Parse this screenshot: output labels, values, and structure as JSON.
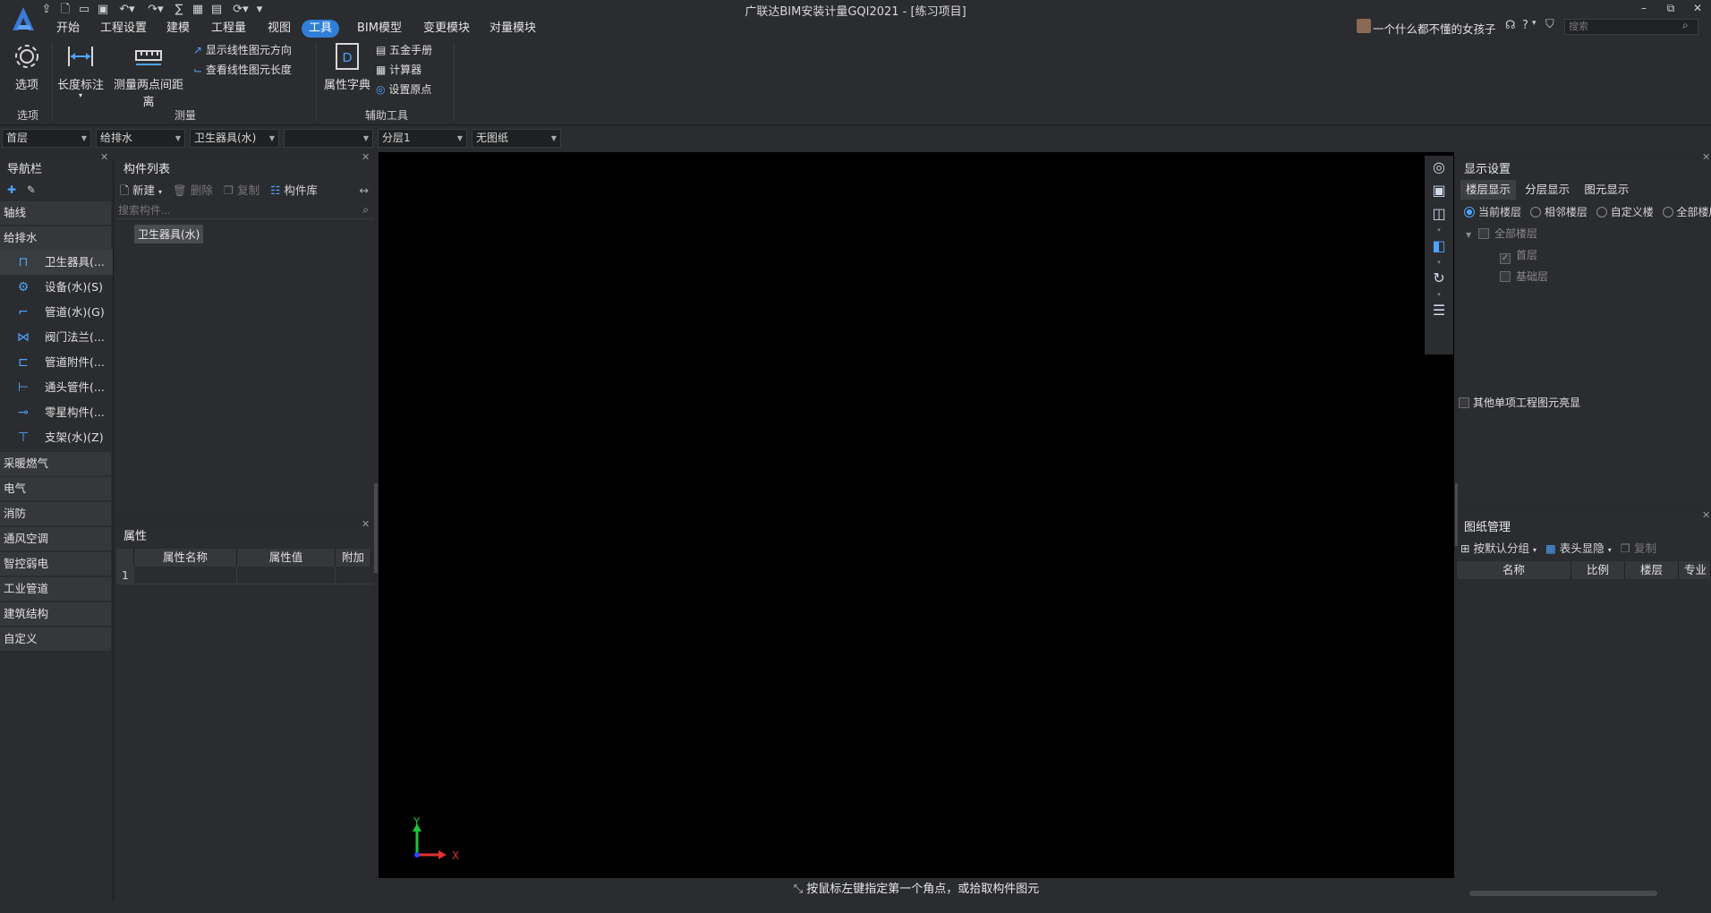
{
  "app": {
    "title": "广联达BIM安装计量GQI2021 - [练习项目]"
  },
  "window": {
    "minimize": "–",
    "restore": "⧉",
    "close": "✕"
  },
  "menus": [
    "开始",
    "工程设置",
    "建模",
    "工程量",
    "视图",
    "工具",
    "BIM模型",
    "变更模块",
    "对量模块"
  ],
  "user": {
    "name": "一个什么都不懂的女孩子",
    "help": "?",
    "search_placeholder": "搜索"
  },
  "ribbon": {
    "options": {
      "label": "选项",
      "group": "选项"
    },
    "measure": {
      "length": "长度标注",
      "distance": "测量两点间距离",
      "show_dir": "显示线性图元方向",
      "check_len": "查看线性图元长度",
      "group": "测量"
    },
    "aux": {
      "dict": "属性字典",
      "hardware": "五金手册",
      "calc": "计算器",
      "origin": "设置原点",
      "group": "辅助工具"
    }
  },
  "filters": [
    "首层",
    "给排水",
    "卫生器具(水)",
    "",
    "分层1",
    "无图纸"
  ],
  "nav": {
    "title": "导航栏",
    "categories_top": [
      "轴线",
      "给排水"
    ],
    "items": [
      "卫生器具(...",
      "设备(水)(S)",
      "管道(水)(G)",
      "阀门法兰(...",
      "管道附件(...",
      "通头管件(...",
      "零星构件(...",
      "支架(水)(Z)"
    ],
    "categories_bottom": [
      "采暖燃气",
      "电气",
      "消防",
      "通风空调",
      "智控弱电",
      "工业管道",
      "建筑结构",
      "自定义"
    ]
  },
  "complist": {
    "title": "构件列表",
    "new": "新建",
    "delete": "删除",
    "copy": "复制",
    "library": "构件库",
    "search_placeholder": "搜索构件...",
    "items": [
      "卫生器具(水)"
    ]
  },
  "props": {
    "title": "属性",
    "headers": [
      "属性名称",
      "属性值",
      "附加"
    ],
    "rows": [
      {
        "no": "1",
        "name": "",
        "value": "",
        "extra": ""
      }
    ]
  },
  "canvas": {
    "axis_x": "X",
    "axis_y": "Y",
    "status": "按鼠标左键指定第一个角点，或拾取构件图元"
  },
  "display": {
    "title": "显示设置",
    "tabs": [
      "楼层显示",
      "分层显示",
      "图元显示"
    ],
    "radios": [
      "当前楼层",
      "相邻楼层",
      "自定义楼",
      "全部楼层"
    ],
    "tree": {
      "root": "全部楼层",
      "children": [
        "首层",
        "基础层"
      ]
    },
    "other": "其他单项工程图元亮显"
  },
  "drawing": {
    "title": "图纸管理",
    "group_btn": "按默认分组",
    "header_btn": "表头显隐",
    "copy": "复制",
    "headers": [
      "名称",
      "比例",
      "楼层",
      "专业"
    ]
  },
  "colors": {
    "accent": "#2f7fd8",
    "icon": "#4fa3ff"
  }
}
